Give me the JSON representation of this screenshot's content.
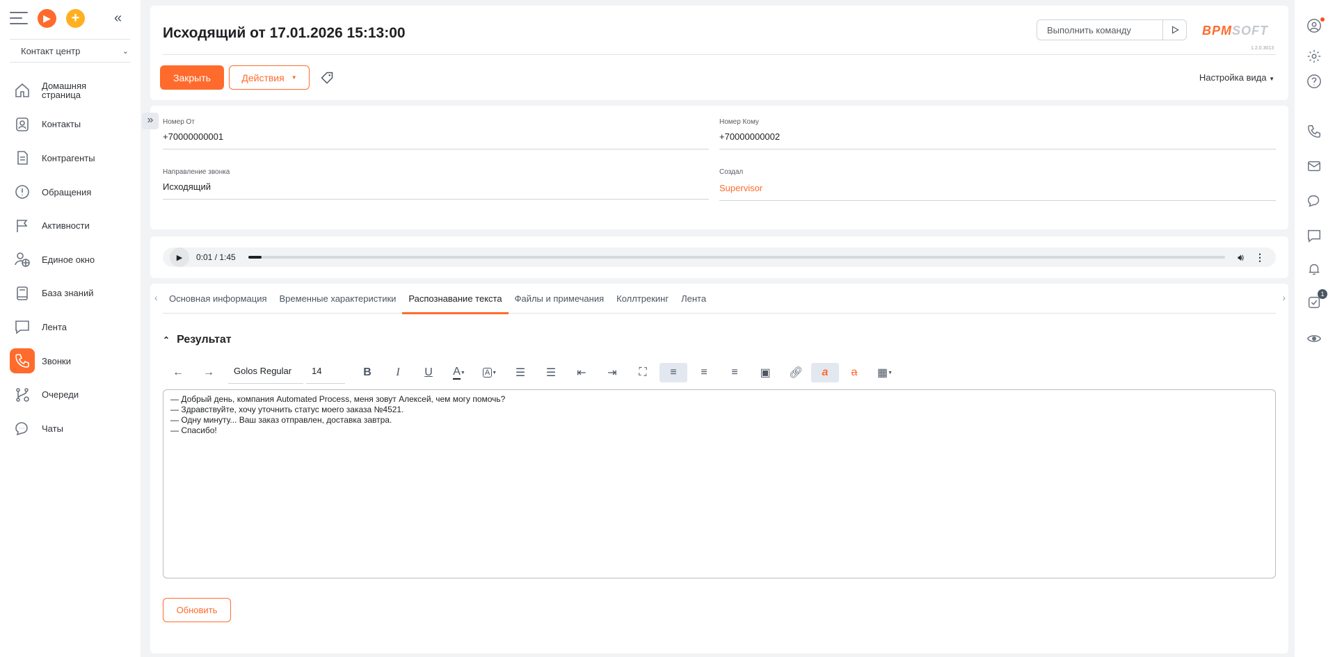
{
  "sidebar": {
    "workspace": "Контакт центр",
    "items": [
      {
        "label": "Домашняя\nстраница",
        "icon": "home-icon"
      },
      {
        "label": "Контакты",
        "icon": "contact-icon"
      },
      {
        "label": "Контрагенты",
        "icon": "document-icon"
      },
      {
        "label": "Обращения",
        "icon": "alert-icon"
      },
      {
        "label": "Активности",
        "icon": "flag-icon"
      },
      {
        "label": "Единое окно",
        "icon": "user-globe-icon"
      },
      {
        "label": "База знаний",
        "icon": "book-icon"
      },
      {
        "label": "Лента",
        "icon": "chat-icon"
      },
      {
        "label": "Звонки",
        "icon": "phone-icon",
        "active": true
      },
      {
        "label": "Очереди",
        "icon": "queue-icon"
      },
      {
        "label": "Чаты",
        "icon": "chats-icon"
      }
    ]
  },
  "header": {
    "title": "Исходящий от 17.01.2026 15:13:00",
    "command_placeholder": "Выполнить команду",
    "logo_a": "BPM",
    "logo_b": "SOFT",
    "version": "1.2.0.3013",
    "close_label": "Закрыть",
    "actions_label": "Действия",
    "view_label": "Настройка вида"
  },
  "fields": {
    "from_caption": "Номер От",
    "from_value": "+70000000001",
    "to_caption": "Номер Кому",
    "to_value": "+70000000002",
    "direction_caption": "Направление звонка",
    "direction_value": "Исходящий",
    "created_caption": "Создал",
    "created_value": "Supervisor"
  },
  "player": {
    "time": "0:01 / 1:45",
    "progress": 0.01
  },
  "tabs": [
    "Основная информация",
    "Временные характеристики",
    "Распознавание текста",
    "Файлы и примечания",
    "Коллтрекинг",
    "Лента"
  ],
  "active_tab": 2,
  "section": {
    "title": "Результат",
    "font": "Golos Regular",
    "size": "14",
    "lines": [
      "— Добрый день, компания Automated Process, меня зовут Алексей, чем могу помочь?",
      "— Здравствуйте, хочу уточнить статус моего заказа №4521.",
      "— Одну минуту... Ваш заказ отправлен, доставка завтра.",
      "— Спасибо!"
    ],
    "refresh_label": "Обновить"
  },
  "rail": {
    "tasks_badge": "1"
  },
  "colors": {
    "accent": "#ff6b2c"
  }
}
